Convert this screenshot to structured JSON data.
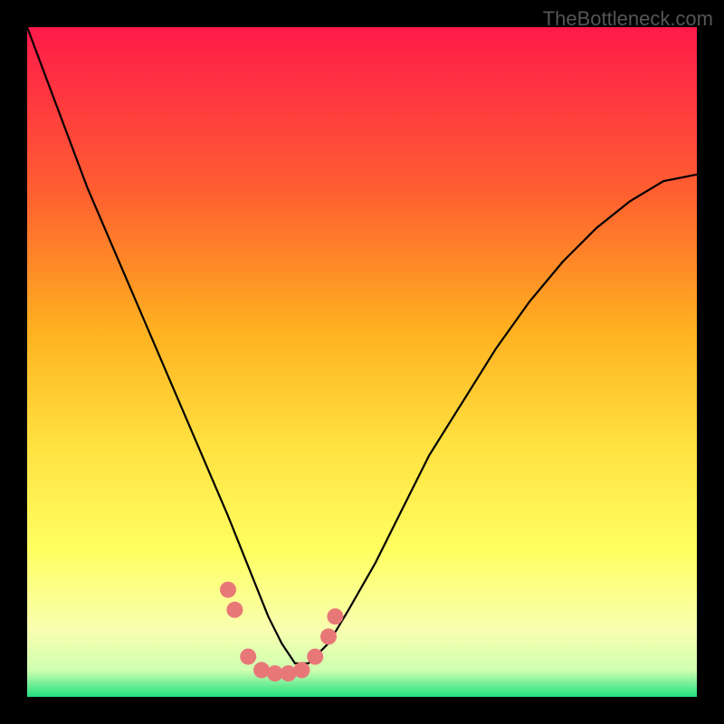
{
  "watermark": "TheBottleneck.com",
  "chart_data": {
    "type": "line",
    "title": "",
    "xlabel": "",
    "ylabel": "",
    "xlim": [
      0,
      100
    ],
    "ylim": [
      0,
      100
    ],
    "gradient_colors": {
      "top": "#ff1a4a",
      "mid_upper": "#ff8020",
      "mid": "#ffe040",
      "mid_lower": "#ffff60",
      "lower": "#f8ffb0",
      "bottom": "#20e080"
    },
    "curve": {
      "description": "V-shaped performance curve with minimum around x=37",
      "x": [
        0,
        3,
        6,
        9,
        12,
        15,
        18,
        21,
        24,
        27,
        30,
        32,
        34,
        36,
        38,
        40,
        42,
        45,
        48,
        52,
        56,
        60,
        65,
        70,
        75,
        80,
        85,
        90,
        95,
        100
      ],
      "y": [
        100,
        92,
        84,
        76,
        69,
        62,
        55,
        48,
        41,
        34,
        27,
        22,
        17,
        12,
        8,
        5,
        5,
        8,
        13,
        20,
        28,
        36,
        44,
        52,
        59,
        65,
        70,
        74,
        77,
        78
      ]
    },
    "markers": {
      "description": "pink circular markers near curve bottom",
      "points": [
        {
          "x": 30,
          "y": 16
        },
        {
          "x": 31,
          "y": 13
        },
        {
          "x": 33,
          "y": 6
        },
        {
          "x": 35,
          "y": 4
        },
        {
          "x": 37,
          "y": 3.5
        },
        {
          "x": 39,
          "y": 3.5
        },
        {
          "x": 41,
          "y": 4
        },
        {
          "x": 43,
          "y": 6
        },
        {
          "x": 45,
          "y": 9
        },
        {
          "x": 46,
          "y": 12
        }
      ],
      "color": "#e87878"
    }
  }
}
